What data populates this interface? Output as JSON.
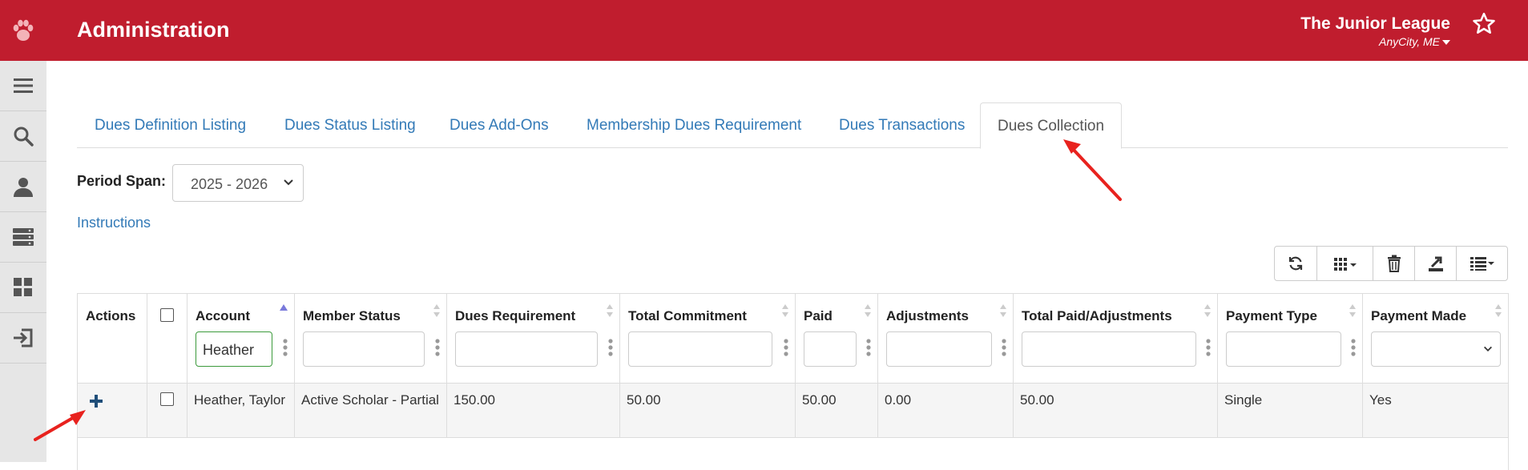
{
  "header": {
    "title": "Administration",
    "org_name": "The Junior League",
    "org_city": "AnyCity, ME"
  },
  "sidebar": {
    "items": [
      "menu-icon",
      "search-icon",
      "user-icon",
      "server-icon",
      "dashboard-icon",
      "logout-icon"
    ]
  },
  "tabs": [
    {
      "label": "Dues Definition Listing"
    },
    {
      "label": "Dues Status Listing"
    },
    {
      "label": "Dues Add-Ons"
    },
    {
      "label": "Membership Dues Requirement"
    },
    {
      "label": "Dues Transactions"
    },
    {
      "label": "Dues Collection",
      "active": true
    }
  ],
  "period": {
    "label": "Period Span:",
    "value": "2025 - 2026"
  },
  "instructions_label": "Instructions",
  "toolbar": {
    "icons": [
      "refresh-icon",
      "columns-icon",
      "trash-icon",
      "export-icon",
      "list-icon"
    ]
  },
  "table": {
    "columns": [
      "Actions",
      "",
      "Account",
      "Member Status",
      "Dues Requirement",
      "Total Commitment",
      "Paid",
      "Adjustments",
      "Total Paid/Adjustments",
      "Payment Type",
      "Payment Made"
    ],
    "filters": {
      "account": "Heather"
    },
    "rows": [
      {
        "account": "Heather, Taylor",
        "member_status": "Active Scholar - Partial",
        "dues_requirement": "150.00",
        "total_commitment": "50.00",
        "paid": "50.00",
        "adjustments": "0.00",
        "total_paid_adjustments": "50.00",
        "payment_type": "Single",
        "payment_made": "Yes"
      }
    ]
  },
  "colors": {
    "brand": "#c01d2e",
    "link": "#337ab7",
    "annotation": "#e8221e"
  }
}
